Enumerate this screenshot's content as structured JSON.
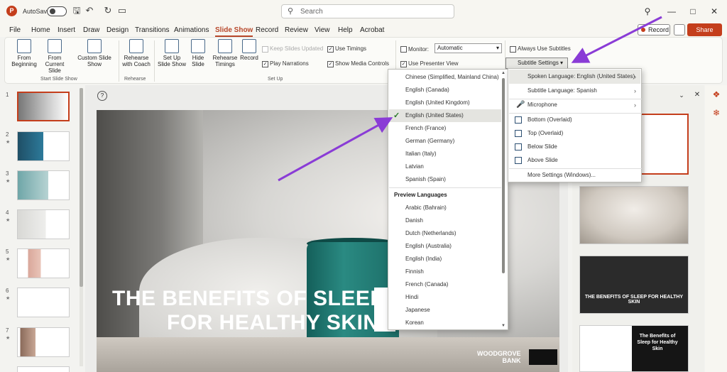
{
  "titlebar": {
    "autosave_label": "AutoSave",
    "search_placeholder": "Search",
    "icons": [
      "save-icon",
      "undo-icon",
      "redo-icon",
      "present-icon",
      "lightbulb-icon",
      "minimize-icon",
      "maximize-icon",
      "close-icon"
    ]
  },
  "menu": {
    "items": [
      "File",
      "Home",
      "Insert",
      "Draw",
      "Design",
      "Transitions",
      "Animations",
      "Slide Show",
      "Record",
      "Review",
      "View",
      "Help",
      "Acrobat"
    ],
    "active": "Slide Show",
    "record_label": "Record",
    "share_label": "Share"
  },
  "ribbon": {
    "start_group": {
      "buttons": [
        "From Beginning",
        "From Current Slide",
        "Custom Slide Show"
      ],
      "label": "Start Slide Show"
    },
    "rehearse_group": {
      "buttons": [
        "Rehearse with Coach"
      ],
      "label": "Rehearse"
    },
    "setup_group": {
      "buttons": [
        "Set Up Slide Show",
        "Hide Slide",
        "Rehearse Timings",
        "Record"
      ],
      "checks": [
        {
          "label": "Keep Slides Updated",
          "checked": false,
          "disabled": true
        },
        {
          "label": "Use Timings",
          "checked": true,
          "disabled": false
        },
        {
          "label": "Play Narrations",
          "checked": true,
          "disabled": false
        },
        {
          "label": "Show Media Controls",
          "checked": true,
          "disabled": false
        }
      ],
      "label": "Set Up"
    },
    "monitors": {
      "monitor_label": "Monitor:",
      "monitor_value": "Automatic",
      "presenter_view_label": "Use Presenter View",
      "presenter_view_checked": true
    },
    "captions": {
      "always_use_subtitles_label": "Always Use Subtitles",
      "always_use_subtitles_checked": false,
      "subtitle_settings_label": "Subtitle Settings"
    }
  },
  "slides": {
    "numbers": [
      "1",
      "2",
      "3",
      "4",
      "5",
      "6",
      "7"
    ],
    "selected": 1
  },
  "main_slide": {
    "title_line1": "THE BENEFITS OF SLEEP",
    "title_line2": "FOR HEALTHY SKIN",
    "brand_line1": "WOODGROVE",
    "brand_line2": "BANK"
  },
  "right_panel": {
    "thumb_dark_title": "THE BENEFITS OF SLEEP FOR HEALTHY SKIN",
    "thumb_last_title": "The Benefits of Sleep for Healthy Skin"
  },
  "language_menu": {
    "items": [
      "Chinese (Simplified, Mainland China)",
      "English (Canada)",
      "English (United Kingdom)",
      "English (United States)",
      "French (France)",
      "German (Germany)",
      "Italian (Italy)",
      "Latvian",
      "Spanish (Spain)"
    ],
    "selected": "English (United States)",
    "preview_header": "Preview Languages",
    "preview_items": [
      "Arabic (Bahrain)",
      "Danish",
      "Dutch (Netherlands)",
      "English (Australia)",
      "English (India)",
      "Finnish",
      "French (Canada)",
      "Hindi",
      "Japanese",
      "Korean"
    ]
  },
  "subtitle_menu": {
    "spoken_language": "Spoken Language: English (United States)",
    "subtitle_language": "Subtitle Language: Spanish",
    "microphone": "Microphone",
    "bottom_overlaid": "Bottom (Overlaid)",
    "top_overlaid": "Top (Overlaid)",
    "below_slide": "Below Slide",
    "above_slide": "Above Slide",
    "more_settings": "More Settings (Windows)..."
  },
  "colors": {
    "accent": "#c43e1c",
    "annotation_arrow": "#8a3cd6"
  }
}
